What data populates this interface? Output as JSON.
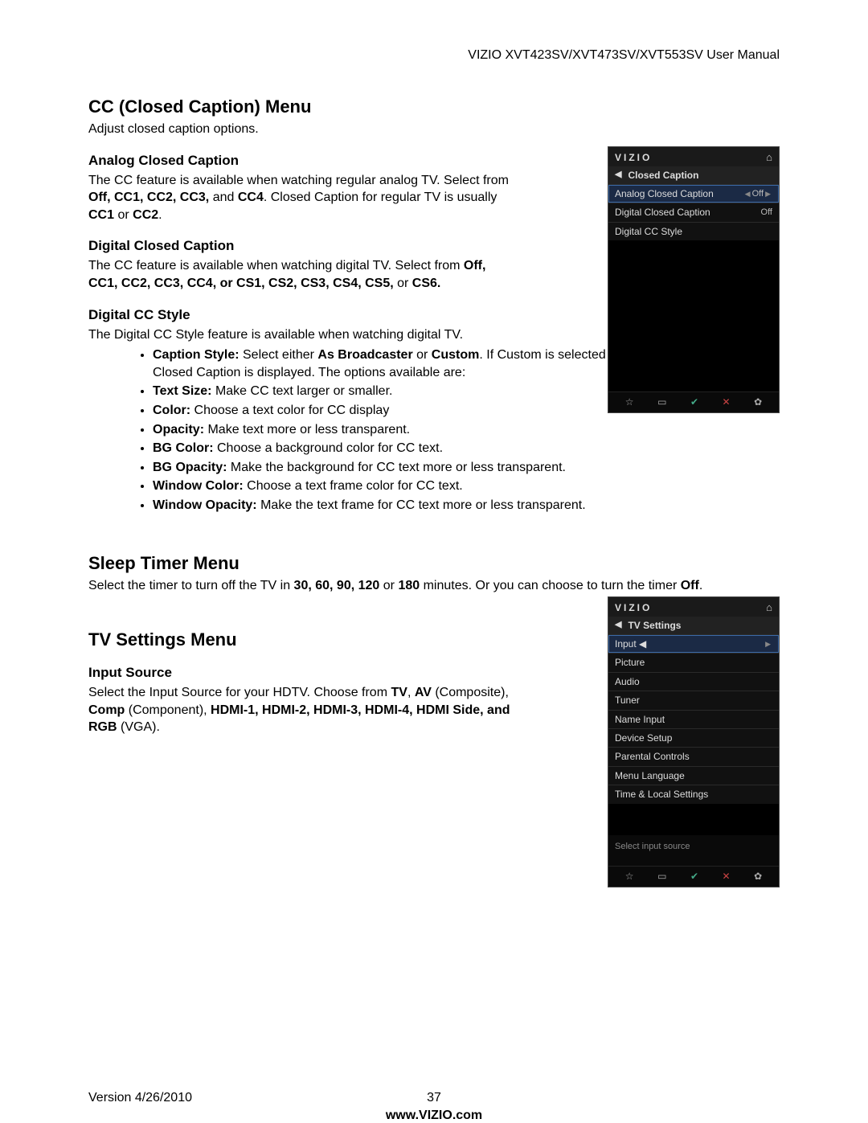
{
  "header": {
    "right": "VIZIO XVT423SV/XVT473SV/XVT553SV User Manual"
  },
  "cc": {
    "heading": "CC (Closed Caption) Menu",
    "intro": "Adjust closed caption options.",
    "analog": {
      "heading": "Analog Closed Caption",
      "p1a": "The CC feature is available when watching regular analog TV. Select from ",
      "p1b": "Off, CC1, CC2, CC3,",
      "p1c": " and ",
      "p1d": "CC4",
      "p1e": ". Closed Caption for regular TV is usually ",
      "p1f": "CC1",
      "p1g": " or ",
      "p1h": "CC2",
      "p1i": "."
    },
    "digital": {
      "heading": "Digital Closed Caption",
      "p1a": "The CC feature is available when watching digital TV. Select from ",
      "p1b": "Off, CC1, CC2, CC3, CC4, or CS1, CS2, CS3, CS4, CS5,",
      "p1c": " or ",
      "p1d": "CS6."
    },
    "style": {
      "heading": "Digital CC Style",
      "intro": "The Digital CC Style feature is available when watching digital TV.",
      "items": {
        "captionStyle": {
          "label": "Caption Style:",
          "t1": " Select either ",
          "as": "As Broadcaster",
          "t2": " or ",
          "custom": "Custom",
          "t3": ". If Custom is selected you can customize the way Closed Caption is displayed. The options available are:"
        },
        "textSize": {
          "label": "Text Size:",
          "desc": " Make CC text larger or smaller."
        },
        "color": {
          "label": "Color:",
          "desc": " Choose a text color for CC display"
        },
        "opacity": {
          "label": "Opacity:",
          "desc": " Make text more or less transparent."
        },
        "bgColor": {
          "label": "BG Color:",
          "desc": " Choose a background color for CC text."
        },
        "bgOpacity": {
          "label": "BG Opacity:",
          "desc": " Make the background for CC text more or less transparent."
        },
        "winColor": {
          "label": "Window Color:",
          "desc": " Choose a text frame color for CC text."
        },
        "winOpacity": {
          "label": "Window Opacity:",
          "desc": " Make the text frame for CC text more or less transparent."
        }
      }
    }
  },
  "sleep": {
    "heading": "Sleep Timer Menu",
    "p1a": "Select the timer to turn off the TV in ",
    "p1b": "30, 60, 90, 120",
    "p1c": " or ",
    "p1d": "180",
    "p1e": " minutes. Or you can choose to turn the timer ",
    "p1f": "Off",
    "p1g": "."
  },
  "tv": {
    "heading": "TV Settings Menu",
    "input": {
      "heading": "Input Source",
      "p1a": "Select the Input Source for your HDTV. Choose from ",
      "tv": "TV",
      "c1": ", ",
      "av": "AV",
      "c2": " (Composite), ",
      "comp": "Comp",
      "c3": " (Component), ",
      "hdmi": "HDMI-1, HDMI-2, HDMI-3, HDMI-4, HDMI Side, and RGB",
      "c4": " (VGA)."
    }
  },
  "osd1": {
    "brand": "VIZIO",
    "title": "Closed Caption",
    "rows": [
      {
        "label": "Analog Closed Caption",
        "value": "Off",
        "selected": true
      },
      {
        "label": "Digital Closed Caption",
        "value": "Off"
      },
      {
        "label": "Digital CC Style",
        "value": ""
      }
    ]
  },
  "osd2": {
    "brand": "VIZIO",
    "title": "TV Settings",
    "rows": [
      {
        "label": "Input",
        "value": "",
        "selected": true,
        "arrows": true
      },
      {
        "label": "Picture"
      },
      {
        "label": "Audio"
      },
      {
        "label": "Tuner"
      },
      {
        "label": "Name Input"
      },
      {
        "label": "Device Setup"
      },
      {
        "label": "Parental Controls"
      },
      {
        "label": "Menu Language"
      },
      {
        "label": "Time & Local Settings"
      }
    ],
    "hint": "Select input source"
  },
  "footer": {
    "version": "Version 4/26/2010",
    "page": "37",
    "url": "www.VIZIO.com"
  }
}
